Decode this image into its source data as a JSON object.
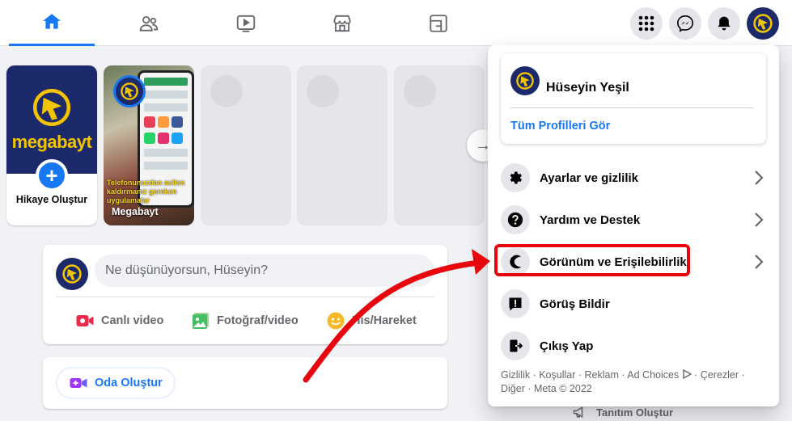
{
  "nav": {
    "tabs": [
      {
        "icon": "home-icon",
        "active": true
      },
      {
        "icon": "friends-icon",
        "active": false
      },
      {
        "icon": "watch-icon",
        "active": false
      },
      {
        "icon": "marketplace-icon",
        "active": false
      },
      {
        "icon": "gaming-icon",
        "active": false
      }
    ],
    "right_icons": [
      "menu-grid-icon",
      "messenger-icon",
      "notifications-icon",
      "account-avatar"
    ],
    "accent_color": "#1877f2"
  },
  "stories": {
    "create": {
      "brand": "megabayt",
      "label": "Hikaye Oluştur"
    },
    "photo": {
      "name": "Megabayt",
      "overlay": "Telefonunuzdan acilen kaldırmanız gereken uygulamalar"
    }
  },
  "composer": {
    "placeholder": "Ne düşünüyorsun, Hüseyin?",
    "actions": {
      "live": "Canlı video",
      "photo": "Fotoğraf/video",
      "feeling": "His/Hareket"
    }
  },
  "room": {
    "label": "Oda Oluştur"
  },
  "menu": {
    "profile_name": "Hüseyin Yeşil",
    "all_profiles": "Tüm Profilleri Gör",
    "items": [
      {
        "label": "Ayarlar ve gizlilik",
        "icon": "gear-icon"
      },
      {
        "label": "Yardım ve Destek",
        "icon": "help-icon"
      },
      {
        "label": "Görünüm ve Erişilebilirlik",
        "icon": "moon-icon"
      },
      {
        "label": "Görüş Bildir",
        "icon": "feedback-icon"
      },
      {
        "label": "Çıkış Yap",
        "icon": "logout-icon"
      }
    ],
    "footer_line1": "Gizlilik · Koşullar · Reklam · Ad Choices",
    "footer_line1b": " · Çerezler ·",
    "footer_line2": "Diğer · Meta © 2022"
  },
  "sidebar_bottom": {
    "label": "Tanıtım Oluştur"
  },
  "annotation": {
    "highlight_color": "#e8060e"
  }
}
